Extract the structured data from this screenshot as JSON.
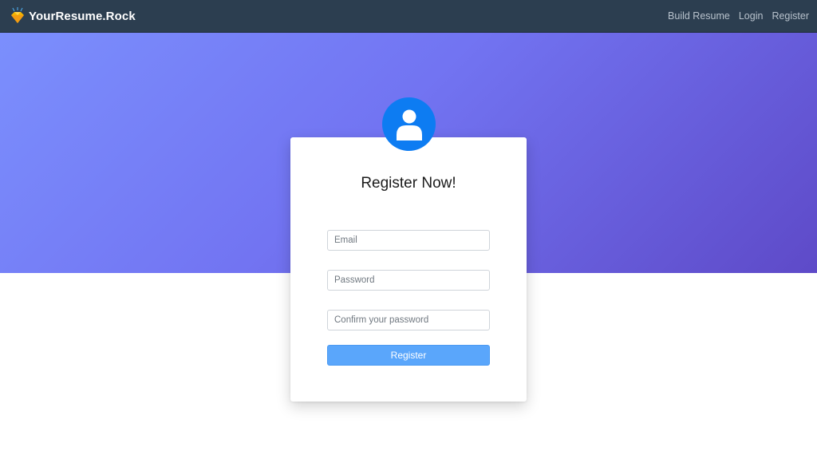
{
  "navbar": {
    "brand": "YourResume.Rock",
    "brand_icon": "diamond-icon",
    "links": [
      {
        "label": "Build Resume"
      },
      {
        "label": "Login"
      },
      {
        "label": "Register"
      }
    ]
  },
  "hero": {
    "gradient_start": "#7b8ffd",
    "gradient_end": "#5e4ac8"
  },
  "card": {
    "avatar_icon": "user-icon",
    "avatar_color": "#0d7cf2",
    "title": "Register Now!",
    "fields": {
      "email_placeholder": "Email",
      "password_placeholder": "Password",
      "confirm_placeholder": "Confirm your password"
    },
    "submit_label": "Register",
    "submit_color": "#5aa6fb"
  }
}
